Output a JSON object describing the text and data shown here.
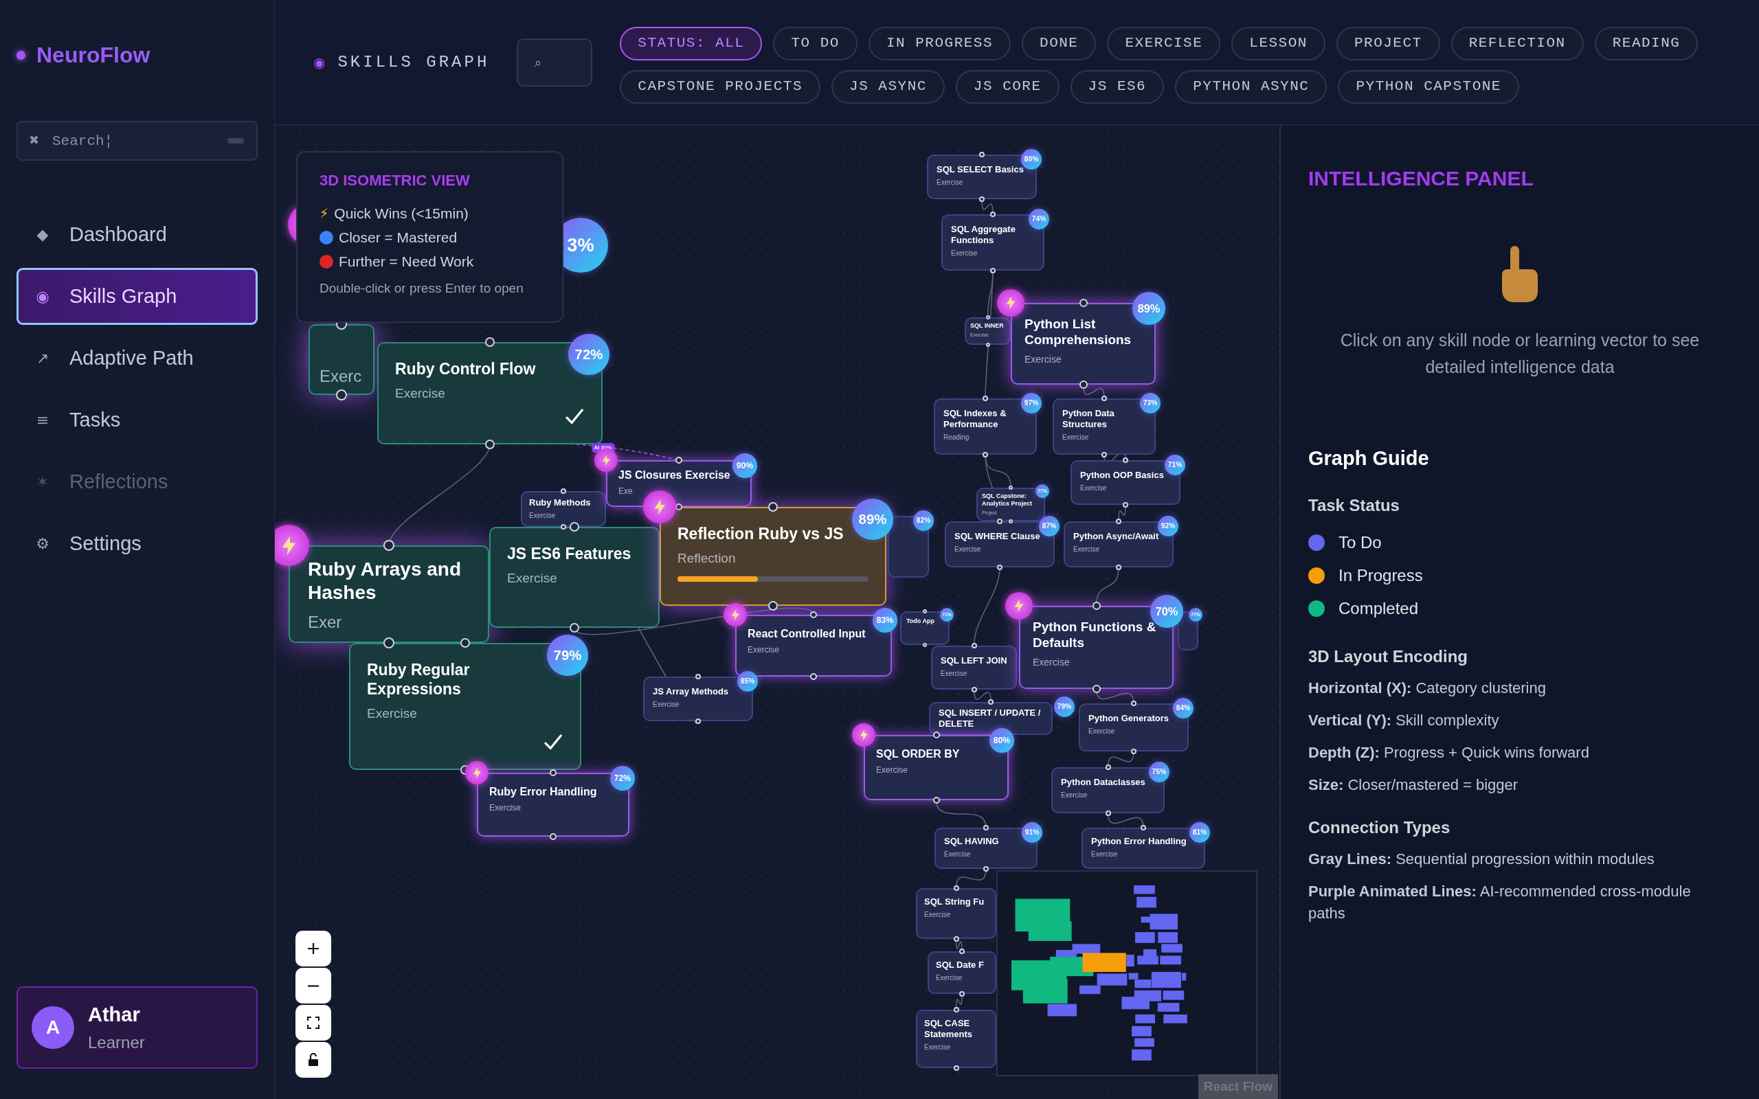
{
  "sidebar": {
    "logo": "NeuroFlow",
    "search": {
      "icon": "✖",
      "placeholder": "Search¦"
    },
    "nav": [
      {
        "icon": "◆",
        "label": "Dashboard",
        "selected": false,
        "disabled": false
      },
      {
        "icon": "◉",
        "label": "Skills Graph",
        "selected": true,
        "disabled": false
      },
      {
        "icon": "↗",
        "label": "Adaptive Path",
        "selected": false,
        "disabled": false
      },
      {
        "icon": "≡",
        "label": "Tasks",
        "selected": false,
        "disabled": false
      },
      {
        "icon": "✶",
        "label": "Reflections",
        "selected": false,
        "disabled": true
      },
      {
        "icon": "⚙",
        "label": "Settings",
        "selected": false,
        "disabled": false
      }
    ],
    "user": {
      "initial": "A",
      "name": "Athar",
      "role": "Learner"
    }
  },
  "header": {
    "icon": "◉",
    "title": "SKILLS GRAPH",
    "search_icon": "⌕",
    "filters": [
      {
        "label": "STATUS: ALL",
        "selected": true
      },
      {
        "label": "TO DO",
        "selected": false
      },
      {
        "label": "IN PROGRESS",
        "selected": false
      },
      {
        "label": "DONE",
        "selected": false
      },
      {
        "label": "EXERCISE",
        "selected": false
      },
      {
        "label": "LESSON",
        "selected": false
      },
      {
        "label": "PROJECT",
        "selected": false
      },
      {
        "label": "REFLECTION",
        "selected": false
      },
      {
        "label": "READING",
        "selected": false
      },
      {
        "label": "CAPSTONE PROJECTS",
        "selected": false
      },
      {
        "label": "JS ASYNC",
        "selected": false
      },
      {
        "label": "JS CORE",
        "selected": false
      },
      {
        "label": "JS ES6",
        "selected": false
      },
      {
        "label": "PYTHON ASYNC",
        "selected": false
      },
      {
        "label": "PYTHON CAPSTONE",
        "selected": false
      }
    ]
  },
  "legend": {
    "title": "3D ISOMETRIC VIEW",
    "items": [
      {
        "kind": "glyph",
        "icon": "⚡",
        "text": "Quick Wins (<15min)"
      },
      {
        "kind": "dot",
        "color": "#3b82f6",
        "text": "Closer = Mastered"
      },
      {
        "kind": "dot",
        "color": "#dc2626",
        "text": "Further = Need Work"
      }
    ],
    "hint": "Double-click or press Enter to open"
  },
  "graph": {
    "nodes": [
      {
        "title": "SQL SELECT Basics",
        "type": "Exercise",
        "percent": "80%",
        "completed": false,
        "in_progress": false,
        "quick_win": false,
        "checked": false
      },
      {
        "title": "SQL Aggregate Functions",
        "type": "Exercise",
        "percent": "74%",
        "completed": false,
        "in_progress": false,
        "quick_win": false,
        "checked": false
      },
      {
        "type": "Exerc",
        "percent": "3%",
        "completed": true,
        "in_progress": false,
        "quick_win": true,
        "checked": false
      },
      {
        "title": "Ruby Control Flow",
        "type": "Exercise",
        "percent": "72%",
        "completed": true,
        "in_progress": false,
        "quick_win": false,
        "checked": true
      },
      {
        "title": "SQL INNER",
        "type": "Exercise",
        "completed": false,
        "in_progress": false,
        "quick_win": false,
        "checked": false
      },
      {
        "title": "Python List Comprehensions",
        "type": "Exercise",
        "percent": "89%",
        "completed": false,
        "in_progress": false,
        "quick_win": true,
        "checked": false
      },
      {
        "title": "SQL Indexes & Performance",
        "type": "Reading",
        "percent": "97%",
        "completed": false,
        "in_progress": false,
        "quick_win": false,
        "checked": false
      },
      {
        "title": "Python Data Structures",
        "type": "Exercise",
        "percent": "73%",
        "completed": false,
        "in_progress": false,
        "quick_win": false,
        "checked": false
      },
      {
        "title": "Ruby Arrays and Hashes",
        "type": "Exer",
        "completed": true,
        "in_progress": false,
        "quick_win": true,
        "checked": false
      },
      {
        "title": "Ruby Methods",
        "type": "Exercise",
        "completed": false,
        "in_progress": false,
        "quick_win": false,
        "checked": false
      },
      {
        "title": "JS Closures Exercise",
        "type": "Exe",
        "percent": "90%",
        "completed": false,
        "in_progress": false,
        "quick_win": true,
        "checked": false
      },
      {
        "title": "JS ES6 Features",
        "type": "Exercise",
        "completed": true,
        "in_progress": false,
        "quick_win": false,
        "checked": false
      },
      {
        "title": "Reflection Ruby vs JS",
        "type": "Reflection",
        "percent": "89%",
        "completed": false,
        "in_progress": true,
        "quick_win": true,
        "checked": false,
        "level": 0.42
      },
      {
        "percent": "82%",
        "completed": false,
        "in_progress": false,
        "quick_win": false,
        "checked": false
      },
      {
        "title": "SQL Capstone: Analytics Project",
        "type": "Project",
        "percent": "77%",
        "completed": false,
        "in_progress": false,
        "quick_win": false,
        "checked": false
      },
      {
        "title": "Python OOP Basics",
        "type": "Exercise",
        "percent": "71%",
        "completed": false,
        "in_progress": false,
        "quick_win": false,
        "checked": false
      },
      {
        "title": "SQL WHERE Clause",
        "type": "Exercise",
        "percent": "87%",
        "completed": false,
        "in_progress": false,
        "quick_win": false,
        "checked": false
      },
      {
        "title": "Python Async/Await",
        "type": "Exercise",
        "percent": "92%",
        "completed": false,
        "in_progress": false,
        "quick_win": false,
        "checked": false
      },
      {
        "title": "Ruby Regular Expressions",
        "type": "Exercise",
        "percent": "79%",
        "completed": true,
        "in_progress": false,
        "quick_win": false,
        "checked": true
      },
      {
        "title": "React Controlled Input",
        "type": "Exercise",
        "percent": "83%",
        "completed": false,
        "in_progress": false,
        "quick_win": true,
        "checked": false
      },
      {
        "title": "Todo App",
        "percent": "71%",
        "completed": false,
        "in_progress": false,
        "quick_win": false,
        "checked": false
      },
      {
        "title": "JS Array Methods",
        "type": "Exercise",
        "percent": "85%",
        "completed": false,
        "in_progress": false,
        "quick_win": false,
        "checked": false
      },
      {
        "title": "SQL LEFT JOIN",
        "type": "Exercise",
        "completed": false,
        "in_progress": false,
        "quick_win": false,
        "checked": false
      },
      {
        "title": "Python Functions & Defaults",
        "type": "Exercise",
        "percent": "70%",
        "completed": false,
        "in_progress": false,
        "quick_win": true,
        "checked": false
      },
      {
        "percent": "77%",
        "completed": false,
        "in_progress": false,
        "quick_win": false,
        "checked": false
      },
      {
        "title": "SQL INSERT / UPDATE / DELETE",
        "percent": "79%",
        "completed": false,
        "in_progress": false,
        "quick_win": false,
        "checked": false
      },
      {
        "title": "Ruby Error Handling",
        "type": "Exercise",
        "percent": "72%",
        "completed": false,
        "in_progress": false,
        "quick_win": true,
        "checked": false
      },
      {
        "title": "SQL ORDER BY",
        "type": "Exercise",
        "percent": "80%",
        "completed": false,
        "in_progress": false,
        "quick_win": true,
        "checked": false
      },
      {
        "title": "Python Generators",
        "type": "Exercise",
        "percent": "84%",
        "completed": false,
        "in_progress": false,
        "quick_win": false,
        "checked": false
      },
      {
        "title": "Python Dataclasses",
        "type": "Exercise",
        "percent": "75%",
        "completed": false,
        "in_progress": false,
        "quick_win": false,
        "checked": false
      },
      {
        "title": "SQL HAVING",
        "type": "Exercise",
        "percent": "91%",
        "completed": false,
        "in_progress": false,
        "quick_win": false,
        "checked": false
      },
      {
        "title": "Python Error Handling",
        "type": "Exercise",
        "percent": "81%",
        "completed": false,
        "in_progress": false,
        "quick_win": false,
        "checked": false
      },
      {
        "title": "SQL String Fu",
        "type": "Exercise",
        "completed": false,
        "in_progress": false,
        "quick_win": false,
        "checked": false
      },
      {
        "title": "SQL Date F",
        "type": "Exercise",
        "completed": false,
        "in_progress": false,
        "quick_win": false,
        "checked": false
      },
      {
        "title": "SQL CASE Statements",
        "type": "Exercise",
        "completed": false,
        "in_progress": false,
        "quick_win": false,
        "checked": false
      }
    ],
    "ai_link_label": "AI 80%",
    "attribution": "React Flow"
  },
  "panel": {
    "title": "INTELLIGENCE PANEL",
    "hint": "Click on any skill node or learning vector to see detailed intelligence data",
    "guide_title": "Graph Guide",
    "sections": [
      {
        "kind": "status",
        "title": "Task Status",
        "items": [
          {
            "label": "To Do",
            "color": "#6366f1"
          },
          {
            "label": "In Progress",
            "color": "#f59e0b"
          },
          {
            "label": "Completed",
            "color": "#10b981"
          }
        ]
      },
      {
        "kind": "text",
        "title": "3D Layout Encoding",
        "items": [
          "**Horizontal (X):** Category clustering",
          "**Vertical (Y):** Skill complexity",
          "**Depth (Z):** Progress + Quick wins forward",
          "**Size:** Closer/mastered = bigger"
        ]
      },
      {
        "kind": "text",
        "title": "Connection Types",
        "items": [
          "**Gray Lines:** Sequential progression within modules",
          "**Purple Animated Lines:** AI-recommended cross-module paths"
        ]
      }
    ]
  }
}
